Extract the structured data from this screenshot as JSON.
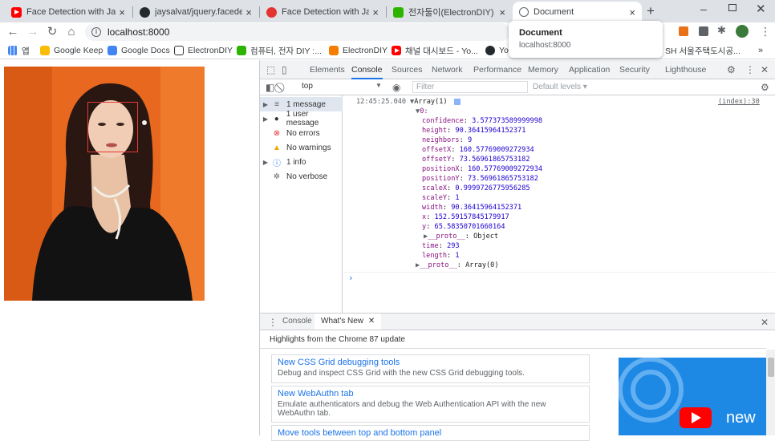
{
  "tabs": [
    {
      "title": "Face Detection with Javasc",
      "icon": "youtube-icon"
    },
    {
      "title": "jaysalvat/jquery.facedetecti",
      "icon": "github-icon"
    },
    {
      "title": "Face Detection with Javasc",
      "icon": "site-icon"
    },
    {
      "title": "전자둘이(ElectronDIY) : 네",
      "icon": "naver-blog-icon"
    },
    {
      "title": "Document",
      "icon": "globe-icon"
    }
  ],
  "toolbar": {
    "url": "localhost:8000"
  },
  "bookmarks": [
    {
      "label": "앱",
      "icon": "apps-icon"
    },
    {
      "label": "Google Keep",
      "icon": "keep-icon"
    },
    {
      "label": "Google Docs",
      "icon": "docs-icon"
    },
    {
      "label": "ElectronDIY",
      "icon": "electrondiy-icon"
    },
    {
      "label": "컴퓨터, 전자 DIY :...",
      "icon": "naver-icon"
    },
    {
      "label": "ElectronDIY",
      "icon": "blogger-icon"
    },
    {
      "label": "채널 대시보드 - Yo...",
      "icon": "youtube-icon"
    },
    {
      "label": "Yo",
      "icon": "github-icon"
    },
    {
      "label": "SH 서울주택도시공...",
      "icon": "sh-icon"
    }
  ],
  "popup": {
    "title": "Document",
    "subtitle": "localhost:8000"
  },
  "devtools": {
    "tabs": [
      "Elements",
      "Console",
      "Sources",
      "Network",
      "Performance",
      "Memory",
      "Application",
      "Security",
      "Lighthouse"
    ],
    "active_tab": "Console",
    "context": "top",
    "filter_placeholder": "Filter",
    "levels": "Default levels ▾",
    "sidebar": [
      {
        "label": "1 message",
        "icon": "list-icon",
        "expandable": true
      },
      {
        "label": "1 user message",
        "icon": "user-icon",
        "expandable": true
      },
      {
        "label": "No errors",
        "icon": "error-icon",
        "expandable": false
      },
      {
        "label": "No warnings",
        "icon": "warning-icon",
        "expandable": false
      },
      {
        "label": "1 info",
        "icon": "info-icon",
        "expandable": true
      },
      {
        "label": "No verbose",
        "icon": "bug-icon",
        "expandable": false
      }
    ],
    "console": {
      "timestamp": "12:45:25.040",
      "summary": "Array(1)",
      "source": "(index):30",
      "index": "0:",
      "props": [
        {
          "key": "confidence",
          "value": "3.577373589999998"
        },
        {
          "key": "height",
          "value": "90.36415964152371"
        },
        {
          "key": "neighbors",
          "value": "9"
        },
        {
          "key": "offsetX",
          "value": "160.57769009272934"
        },
        {
          "key": "offsetY",
          "value": "73.56961865753182"
        },
        {
          "key": "positionX",
          "value": "160.57769009272934"
        },
        {
          "key": "positionY",
          "value": "73.56961865753182"
        },
        {
          "key": "scaleX",
          "value": "0.9999726775956285"
        },
        {
          "key": "scaleY",
          "value": "1"
        },
        {
          "key": "width",
          "value": "90.36415964152371"
        },
        {
          "key": "x",
          "value": "152.59157845179917"
        },
        {
          "key": "y",
          "value": "65.58350701660164"
        }
      ],
      "proto_inner": "Object",
      "time": "293",
      "length": "1",
      "proto_outer": "Array(0)",
      "prompt": "›"
    },
    "drawer": {
      "tabs": [
        "Console",
        "What's New"
      ],
      "active": "What's New",
      "heading": "Highlights from the Chrome 87 update",
      "cards": [
        {
          "title": "New CSS Grid debugging tools",
          "desc": "Debug and inspect CSS Grid with the new CSS Grid debugging tools."
        },
        {
          "title": "New WebAuthn tab",
          "desc": "Emulate authenticators and debug the Web Authentication API with the new WebAuthn tab."
        },
        {
          "title": "Move tools between top and bottom panel",
          "desc": ""
        }
      ],
      "video_label": "new"
    }
  }
}
